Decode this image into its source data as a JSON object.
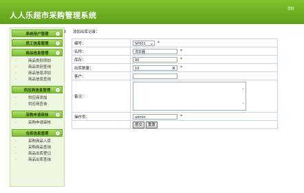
{
  "header": {
    "title": "人人乐超市采购管理系统",
    "top_link": "您好"
  },
  "sidebar": {
    "sections": [
      {
        "label": "系统用户管理",
        "toggle": "«",
        "items": []
      },
      {
        "label": "员工信息管理",
        "toggle": "«",
        "items": []
      },
      {
        "label": "商品信息管理",
        "toggle": "»",
        "items": [
          "商品类别添加",
          "商品类别查询",
          "商品信息添加",
          "商品信息查询"
        ]
      },
      {
        "label": "供应商信息管理",
        "toggle": "»",
        "items": [
          "供应商添加",
          "供应商查询"
        ]
      },
      {
        "label": "采购申请审核",
        "toggle": "»",
        "items": [
          "采购申请审核"
        ]
      },
      {
        "label": "仓库信息管理",
        "toggle": "»",
        "items": [
          "采购商品入库",
          "采购商品查询",
          "商品出库登记",
          "商品出库查询"
        ]
      }
    ],
    "bullet": "◦"
  },
  "collapse_icon": "∧",
  "page": {
    "heading": "添加出库记录："
  },
  "form": {
    "required_mark": "*",
    "fields": {
      "code": {
        "label": "编号：",
        "value": "SP001"
      },
      "name": {
        "label": "名称：",
        "value": "洗车器"
      },
      "stock": {
        "label": "库存：",
        "value": "90"
      },
      "out_qty": {
        "label": "出库数量：",
        "value": "10"
      },
      "customer": {
        "label": "客户：",
        "value": ""
      },
      "remark": {
        "label": "备注：",
        "value": ""
      },
      "operator": {
        "label": "操作员：",
        "value": "admin"
      }
    },
    "submit_label": "提交",
    "reset_label": "重置"
  }
}
